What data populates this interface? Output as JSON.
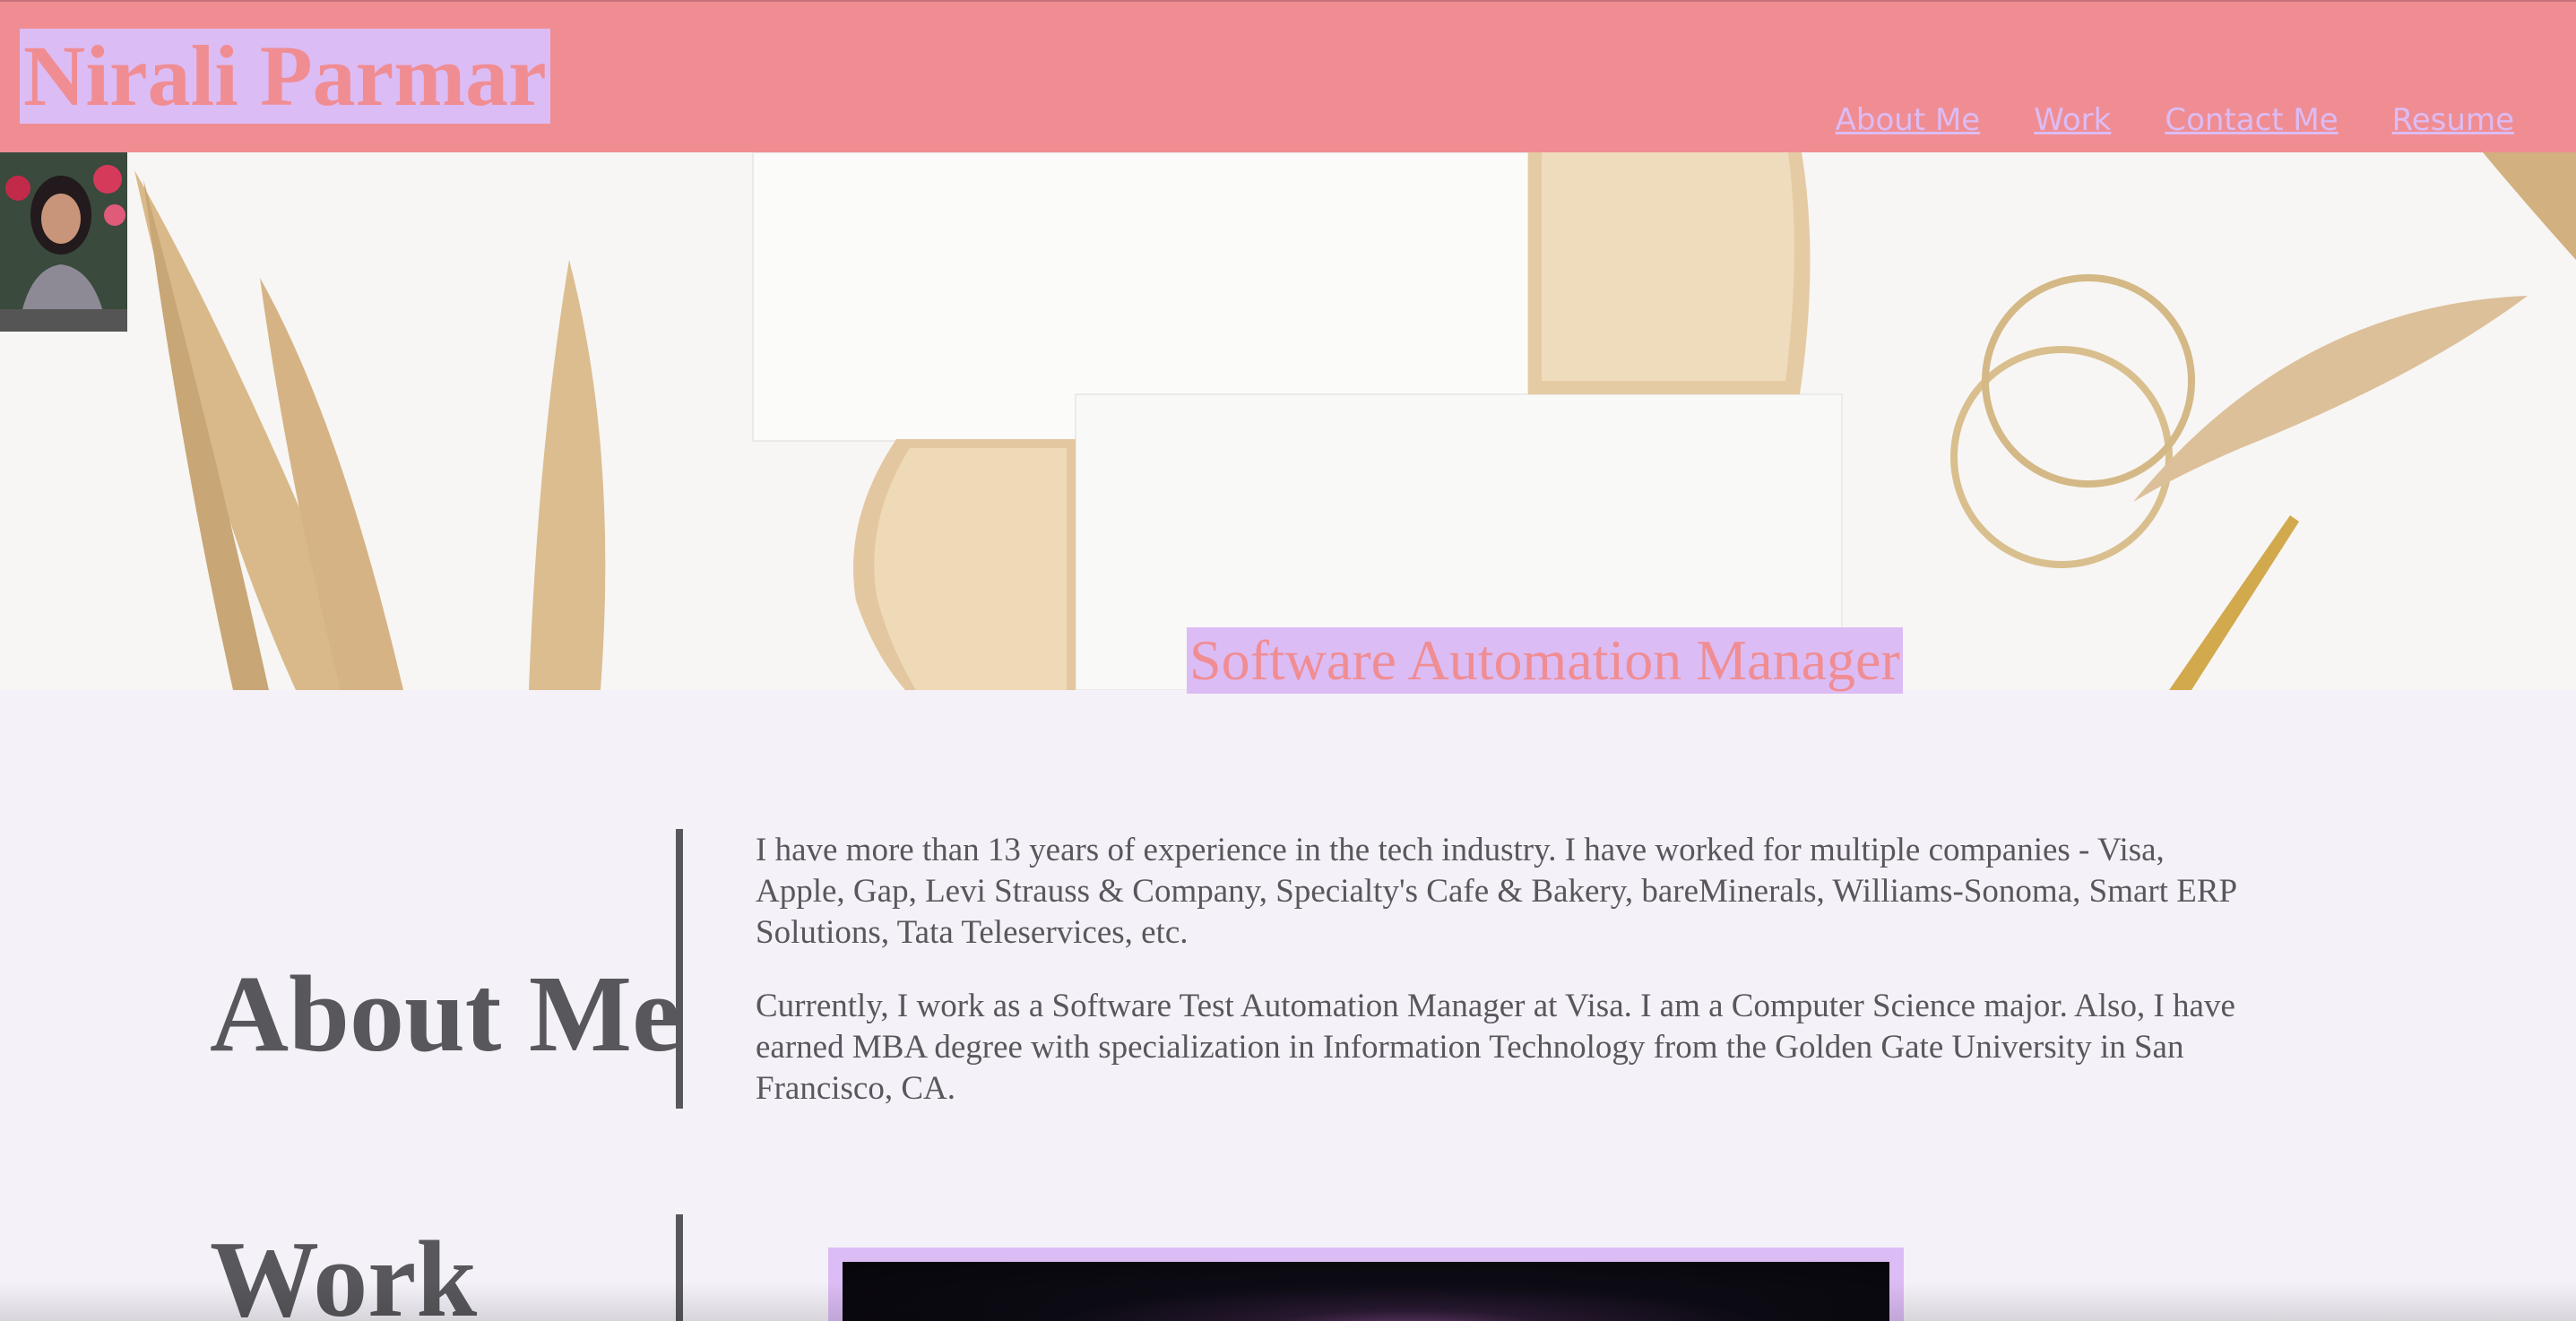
{
  "header": {
    "title": "Nirali Parmar",
    "nav": [
      "About Me",
      "Work",
      "Contact Me",
      "Resume"
    ]
  },
  "hero": {
    "subtitle": "Software Automation Manager"
  },
  "about": {
    "heading": "About Me",
    "paragraphs": [
      "I have more than 13 years of experience in the tech industry. I have worked for multiple companies - Visa, Apple, Gap, Levi Strauss & Company, Specialty's Cafe & Bakery, bareMinerals, Williams-Sonoma, Smart ERP Solutions, Tata Teleservices, etc.",
      "Currently, I work as a Software Test Automation Manager at Visa. I am a Computer Science major. Also, I have earned MBA degree with specialization in Information Technology from the Golden Gate University in San Francisco, CA."
    ]
  },
  "work": {
    "heading": "Work"
  },
  "colors": {
    "header_bg": "#f08d93",
    "accent_lavender": "#dcbcf4",
    "text_gray": "#58575b",
    "page_bg": "#f5f1f9"
  }
}
